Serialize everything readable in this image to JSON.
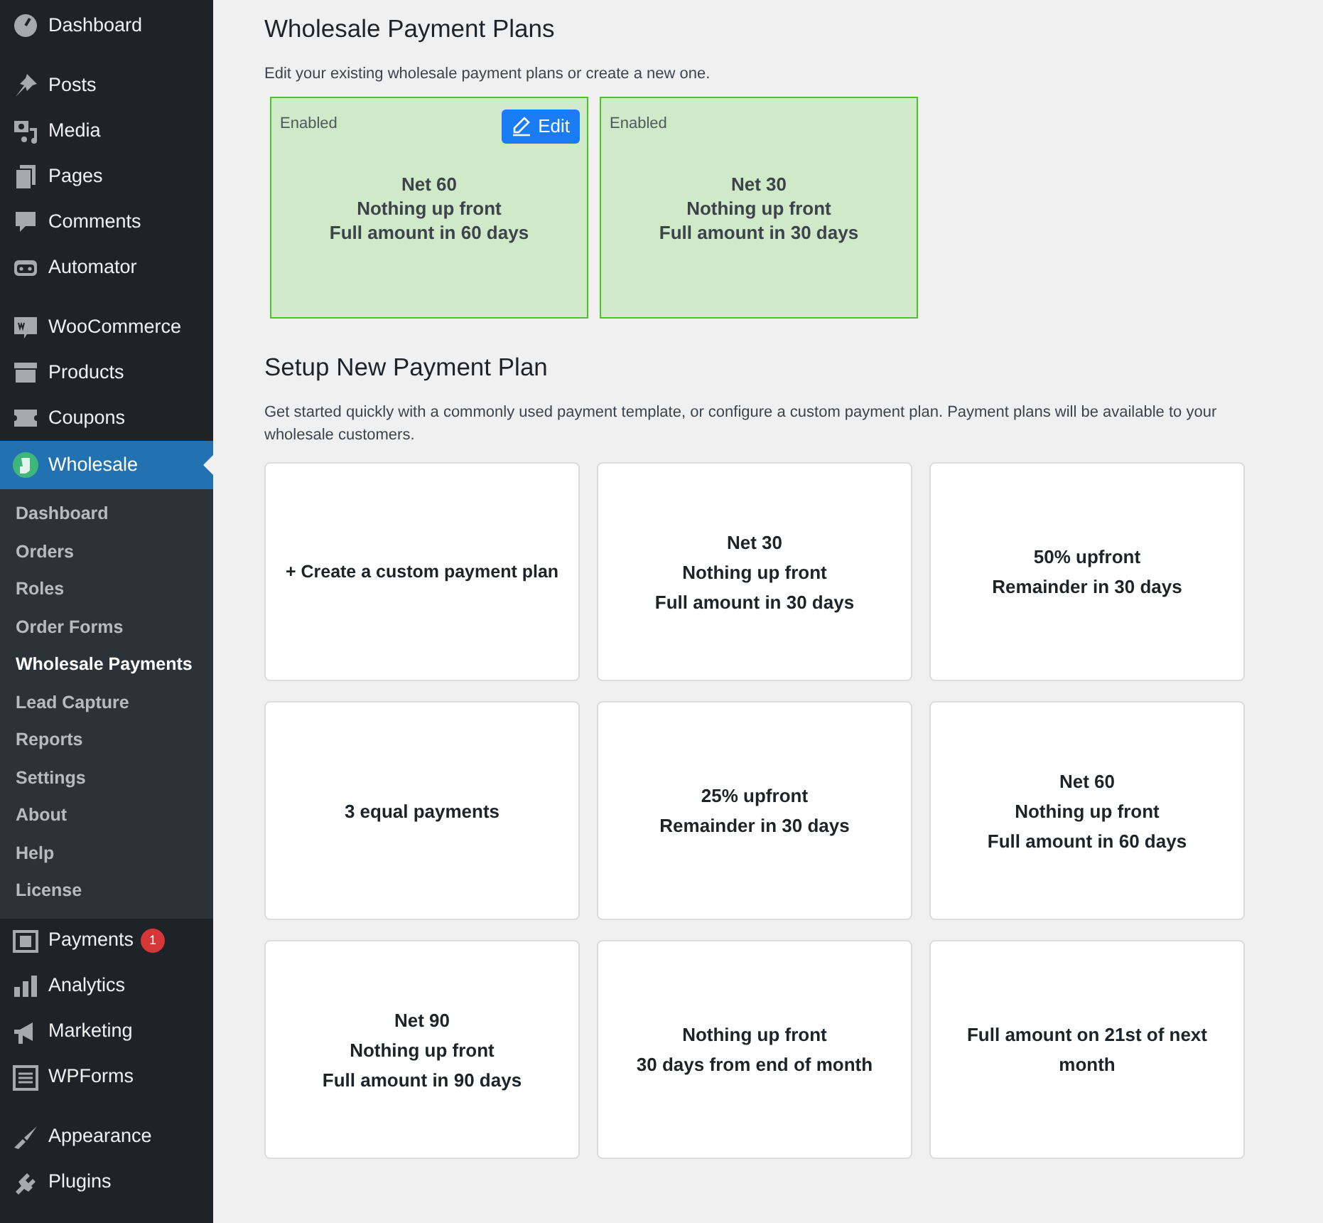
{
  "sidebar": {
    "groups": [
      [
        {
          "label": "Dashboard",
          "kind": "gauge",
          "selected": false
        }
      ],
      [
        {
          "label": "Posts",
          "kind": "pin",
          "selected": false
        },
        {
          "label": "Media",
          "kind": "media",
          "selected": false
        },
        {
          "label": "Pages",
          "kind": "pages",
          "selected": false
        },
        {
          "label": "Comments",
          "kind": "comment",
          "selected": false
        },
        {
          "label": "Automator",
          "kind": "robot",
          "selected": false
        }
      ],
      [
        {
          "label": "WooCommerce",
          "kind": "woo",
          "selected": false
        },
        {
          "label": "Products",
          "kind": "box",
          "selected": false
        },
        {
          "label": "Coupons",
          "kind": "ticket",
          "selected": false
        },
        {
          "label": "Wholesale",
          "kind": "wholesale",
          "selected": true,
          "children": [
            {
              "label": "Dashboard",
              "selected": false
            },
            {
              "label": "Orders",
              "selected": false
            },
            {
              "label": "Roles",
              "selected": false
            },
            {
              "label": "Order Forms",
              "selected": false
            },
            {
              "label": "Wholesale Payments",
              "selected": true
            },
            {
              "label": "Lead Capture",
              "selected": false
            },
            {
              "label": "Reports",
              "selected": false
            },
            {
              "label": "Settings",
              "selected": false
            },
            {
              "label": "About",
              "selected": false
            },
            {
              "label": "Help",
              "selected": false
            },
            {
              "label": "License",
              "selected": false
            }
          ]
        },
        {
          "label": "Payments",
          "kind": "dollar",
          "selected": false,
          "badge": "1"
        },
        {
          "label": "Analytics",
          "kind": "bars",
          "selected": false
        },
        {
          "label": "Marketing",
          "kind": "megaphone",
          "selected": false
        },
        {
          "label": "WPForms",
          "kind": "form",
          "selected": false
        }
      ],
      [
        {
          "label": "Appearance",
          "kind": "brush",
          "selected": false
        },
        {
          "label": "Plugins",
          "kind": "plug",
          "selected": false
        }
      ]
    ]
  },
  "existing": {
    "title": "Wholesale Payment Plans",
    "description": "Edit your existing wholesale payment plans or create a new one.",
    "plans": [
      {
        "status": "Enabled",
        "lines": [
          "Net 60",
          "Nothing up front",
          "Full amount in 60 days"
        ],
        "edit_button": "Edit"
      },
      {
        "status": "Enabled",
        "lines": [
          "Net 30",
          "Nothing up front",
          "Full amount in 30 days"
        ]
      }
    ]
  },
  "setup": {
    "title": "Setup New Payment Plan",
    "description": "Get started quickly with a commonly used payment template, or configure a custom payment plan. Payment plans will be available to your wholesale customers.",
    "templates": [
      {
        "kind": "custom",
        "symbol": "+",
        "lines": [
          "Create a custom payment plan"
        ]
      },
      {
        "kind": "template",
        "lines": [
          "Net 30",
          "Nothing up front",
          "Full amount in 30 days"
        ]
      },
      {
        "kind": "template",
        "lines": [
          "50% upfront",
          "Remainder in 30 days"
        ]
      },
      {
        "kind": "template",
        "lines": [
          "3 equal payments"
        ]
      },
      {
        "kind": "template",
        "lines": [
          "25% upfront",
          "Remainder in 30 days"
        ]
      },
      {
        "kind": "template",
        "lines": [
          "Net 60",
          "Nothing up front",
          "Full amount in 60 days"
        ]
      },
      {
        "kind": "template",
        "lines": [
          "Net 90",
          "Nothing up front",
          "Full amount in 90 days"
        ]
      },
      {
        "kind": "template",
        "lines": [
          "Nothing up front",
          "30 days from end of month"
        ]
      },
      {
        "kind": "template",
        "lines": [
          "Full amount on 21st of next month"
        ]
      }
    ]
  }
}
